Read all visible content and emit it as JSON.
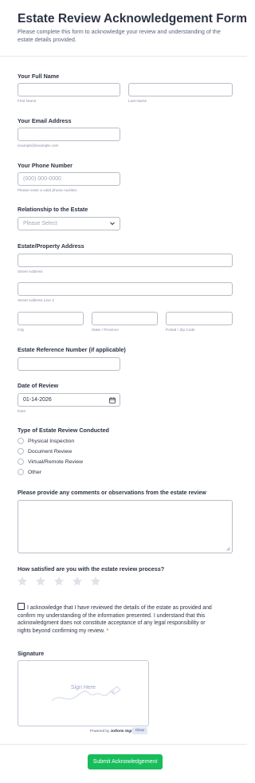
{
  "form": {
    "title": "Estate Review Acknowledgement Form",
    "subtitle": "Please complete this form to acknowledge your review and understanding of the estate details provided."
  },
  "full_name": {
    "label": "Your Full Name",
    "first_sublabel": "First Name",
    "last_sublabel": "Last Name"
  },
  "email": {
    "label": "Your Email Address",
    "sublabel": "example@example.com"
  },
  "phone": {
    "label": "Your Phone Number",
    "placeholder": "(000) 000-0000",
    "sublabel": "Please enter a valid phone number."
  },
  "relationship": {
    "label": "Relationship to the Estate",
    "selected": "Please Select"
  },
  "address": {
    "label": "Estate/Property Address",
    "street_sublabel": "Street Address",
    "street2_sublabel": "Street Address Line 2",
    "city_sublabel": "City",
    "state_sublabel": "State / Province",
    "zip_sublabel": "Postal / Zip Code"
  },
  "reference": {
    "label": "Estate Reference Number (if applicable)"
  },
  "date": {
    "label": "Date of Review",
    "value": "01-14-2026",
    "sublabel": "Date"
  },
  "review_type": {
    "label": "Type of Estate Review Conducted",
    "options": [
      "Physical Inspection",
      "Document Review",
      "Virtual/Remote Review",
      "Other"
    ]
  },
  "comments": {
    "label": "Please provide any comments or observations from the estate review"
  },
  "rating": {
    "label": "How satisfied are you with the estate review process?",
    "max": 5,
    "value": 0
  },
  "acknowledge": {
    "text": "I acknowledge that I have reviewed the details of the estate as provided and confirm my understanding of the information presented. I understand that this acknowledgment does not constitute acceptance of any legal responsibility or rights beyond confirming my review.",
    "required_mark": "*"
  },
  "signature": {
    "label": "Signature",
    "placeholder": "Sign Here",
    "powered_prefix": "Powered by",
    "powered_brand": "Jotform Sign",
    "clear_label": "Clear"
  },
  "submit": {
    "label": "Submit Acknowledgement"
  },
  "colors": {
    "accent": "#18bd5b",
    "text": "#2c3345",
    "required": "#e33b3b",
    "border": "#b8bdc9"
  }
}
